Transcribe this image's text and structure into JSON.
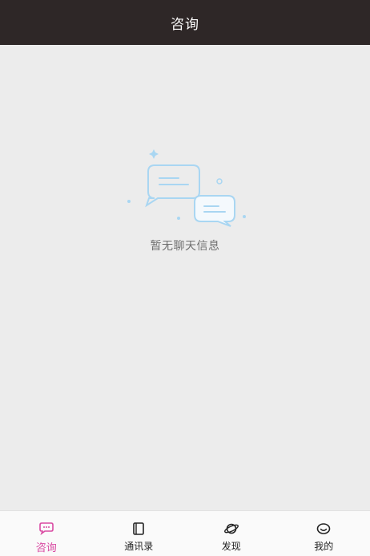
{
  "header": {
    "title": "咨询"
  },
  "main": {
    "empty_state": {
      "text": "暂无聊天信息",
      "illustration_icon": "chat-bubbles-icon"
    }
  },
  "tabbar": {
    "active_tab": "consult",
    "active_color": "#d94aa2",
    "tabs": [
      {
        "id": "consult",
        "label": "咨询",
        "icon": "chat-bubble-icon"
      },
      {
        "id": "contacts",
        "label": "通讯录",
        "icon": "address-book-icon"
      },
      {
        "id": "discover",
        "label": "发现",
        "icon": "planet-icon"
      },
      {
        "id": "mine",
        "label": "我的",
        "icon": "profile-face-icon"
      }
    ]
  },
  "colors": {
    "header_bg": "#2e2727",
    "page_bg": "#ececec",
    "illustration_blue": "#a9d6f2"
  }
}
